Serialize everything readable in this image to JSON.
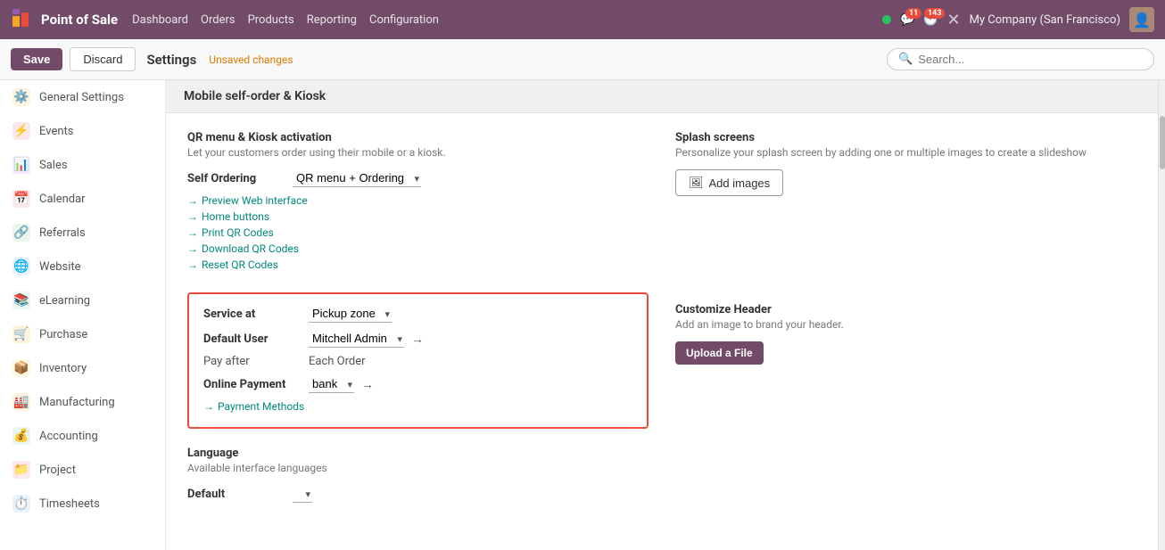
{
  "app": {
    "name": "Point of Sale",
    "logo_emoji": "🧡"
  },
  "nav": {
    "links": [
      "Dashboard",
      "Orders",
      "Products",
      "Reporting",
      "Configuration"
    ],
    "notifications_count": "11",
    "activity_count": "143",
    "company": "My Company (San Francisco)"
  },
  "toolbar": {
    "save_label": "Save",
    "discard_label": "Discard",
    "settings_label": "Settings",
    "unsaved_label": "Unsaved changes",
    "search_placeholder": "Search..."
  },
  "sidebar": {
    "items": [
      {
        "id": "general-settings",
        "label": "General Settings",
        "icon": "⚙️",
        "color": "#e67e22",
        "active": false
      },
      {
        "id": "events",
        "label": "Events",
        "icon": "⚡",
        "color": "#e74c3c",
        "active": false
      },
      {
        "id": "sales",
        "label": "Sales",
        "icon": "📊",
        "color": "#9b59b6",
        "active": false
      },
      {
        "id": "calendar",
        "label": "Calendar",
        "icon": "📅",
        "color": "#e74c3c",
        "active": false
      },
      {
        "id": "referrals",
        "label": "Referrals",
        "icon": "🔗",
        "color": "#27ae60",
        "active": false
      },
      {
        "id": "website",
        "label": "Website",
        "icon": "🌐",
        "color": "#2980b9",
        "active": false
      },
      {
        "id": "elearning",
        "label": "eLearning",
        "icon": "📚",
        "color": "#27ae60",
        "active": false
      },
      {
        "id": "purchase",
        "label": "Purchase",
        "icon": "🛒",
        "color": "#e67e22",
        "active": false
      },
      {
        "id": "inventory",
        "label": "Inventory",
        "icon": "📦",
        "color": "#f39c12",
        "active": false
      },
      {
        "id": "manufacturing",
        "label": "Manufacturing",
        "icon": "🏭",
        "color": "#e67e22",
        "active": false
      },
      {
        "id": "accounting",
        "label": "Accounting",
        "icon": "💰",
        "color": "#27ae60",
        "active": false
      },
      {
        "id": "project",
        "label": "Project",
        "icon": "📁",
        "color": "#e74c3c",
        "active": false
      },
      {
        "id": "timesheets",
        "label": "Timesheets",
        "icon": "⏱️",
        "color": "#2980b9",
        "active": false
      }
    ]
  },
  "main": {
    "section_title": "Mobile self-order & Kiosk",
    "qr_block": {
      "title": "QR menu & Kiosk activation",
      "desc": "Let your customers order using their mobile or a kiosk.",
      "self_ordering_label": "Self Ordering",
      "self_ordering_value": "QR menu + Ordering",
      "links": [
        "Preview Web interface",
        "Home buttons",
        "Print QR Codes",
        "Download QR Codes",
        "Reset QR Codes"
      ]
    },
    "service_block": {
      "service_at_label": "Service at",
      "service_at_value": "Pickup zone",
      "default_user_label": "Default User",
      "default_user_value": "Mitchell Admin",
      "pay_after_label": "Pay after",
      "pay_after_value": "Each Order",
      "online_payment_label": "Online Payment",
      "online_payment_value": "bank",
      "payment_methods_link": "Payment Methods"
    },
    "splash_block": {
      "title": "Splash screens",
      "desc": "Personalize your splash screen by adding one or multiple images to create a slideshow",
      "add_images_label": "Add images"
    },
    "language_block": {
      "title": "Language",
      "desc": "Available interface languages",
      "default_label": "Default"
    },
    "customize_header_block": {
      "title": "Customize Header",
      "desc": "Add an image to brand your header.",
      "upload_label": "Upload a File"
    }
  }
}
